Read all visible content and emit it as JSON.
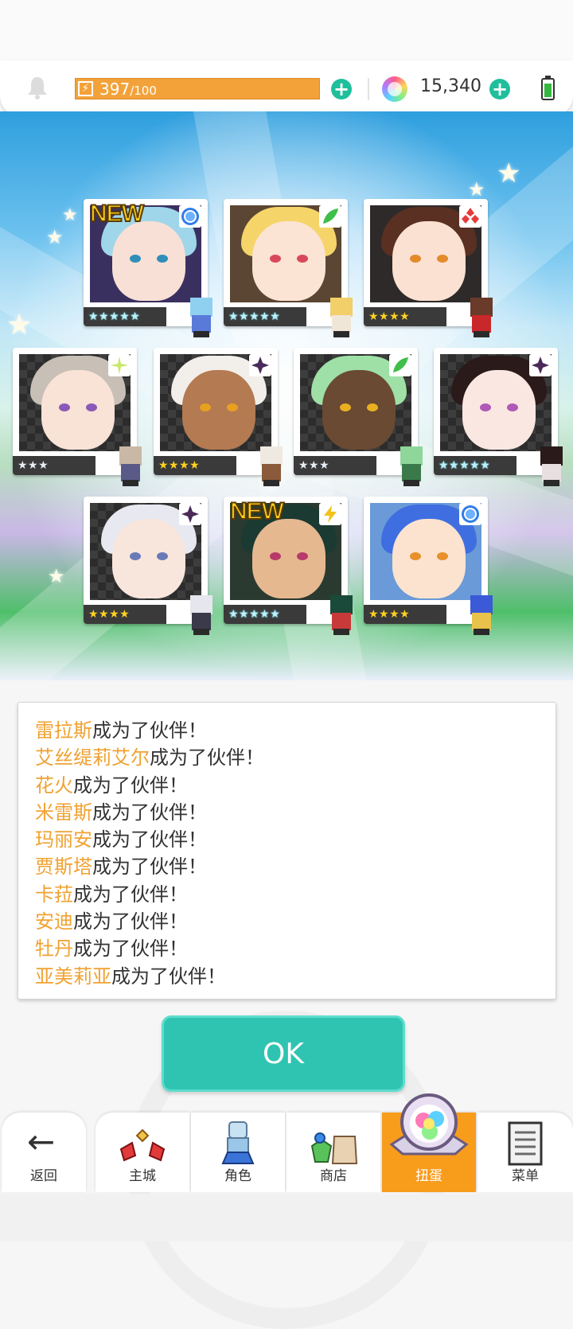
{
  "header": {
    "stamina_current": "397",
    "stamina_max": "/100",
    "stamina_level": 1.0,
    "gem_count": "15,340"
  },
  "log": [
    {
      "name": "雷拉斯",
      "suffix": "成为了伙伴！"
    },
    {
      "name": "艾丝缇莉艾尔",
      "suffix": "成为了伙伴！"
    },
    {
      "name": "花火",
      "suffix": "成为了伙伴！"
    },
    {
      "name": "米雷斯",
      "suffix": "成为了伙伴！"
    },
    {
      "name": "玛丽安",
      "suffix": "成为了伙伴！"
    },
    {
      "name": "贾斯塔",
      "suffix": "成为了伙伴！"
    },
    {
      "name": "卡菈",
      "suffix": "成为了伙伴！"
    },
    {
      "name": "安迪",
      "suffix": "成为了伙伴！"
    },
    {
      "name": "牡丹",
      "suffix": "成为了伙伴！"
    },
    {
      "name": "亚美莉亚",
      "suffix": "成为了伙伴！"
    }
  ],
  "ok_label": "OK",
  "cards": [
    {
      "new_label": "NEW",
      "stars": "★★★★★",
      "rarity": 5,
      "element_icon": "water-circle-icon"
    },
    {
      "new_label": "",
      "stars": "★★★★★",
      "rarity": 5,
      "element_icon": "leaf-icon"
    },
    {
      "new_label": "",
      "stars": "★★★★",
      "rarity": 4,
      "element_icon": "fire-diamond-icon"
    },
    {
      "new_label": "",
      "stars": "★★★",
      "rarity": 3,
      "element_icon": "light-sparkle-icon"
    },
    {
      "new_label": "",
      "stars": "★★★★",
      "rarity": 4,
      "element_icon": "dark-star-icon"
    },
    {
      "new_label": "",
      "stars": "★★★",
      "rarity": 3,
      "element_icon": "leaf-icon"
    },
    {
      "new_label": "",
      "stars": "★★★★★",
      "rarity": 5,
      "element_icon": "dark-star-icon"
    },
    {
      "new_label": "",
      "stars": "★★★★",
      "rarity": 4,
      "element_icon": "dark-star-icon"
    },
    {
      "new_label": "NEW",
      "stars": "★★★★★",
      "rarity": 5,
      "element_icon": "thunder-icon"
    },
    {
      "new_label": "",
      "stars": "★★★★",
      "rarity": 4,
      "element_icon": "water-circle-icon"
    }
  ],
  "nav": {
    "back": "返回",
    "town": "主城",
    "characters": "角色",
    "shop": "商店",
    "gacha": "扭蛋",
    "menu": "菜单",
    "active": "gacha"
  },
  "colors": {
    "accent_teal": "#2fc4b2",
    "stamina_orange": "#f3a23a",
    "nav_active": "#f89c1c",
    "name_highlight": "#f0a232"
  }
}
